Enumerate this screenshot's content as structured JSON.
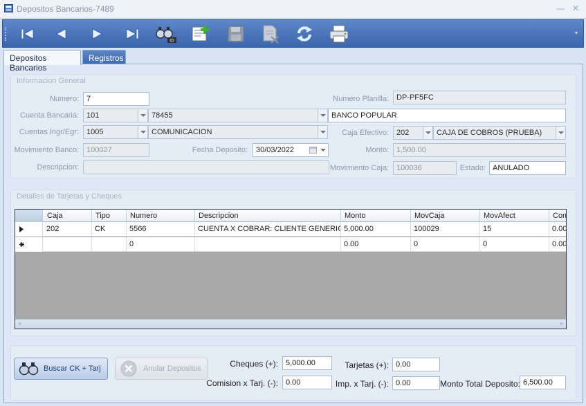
{
  "window": {
    "title": "Depositos Bancarios-7489",
    "min_symbol": "—",
    "close_symbol": "✕"
  },
  "toolbar": {
    "buttons": [
      {
        "name": "first-record-icon"
      },
      {
        "name": "previous-record-icon"
      },
      {
        "name": "next-record-icon"
      },
      {
        "name": "last-record-icon"
      },
      {
        "name": "find-by-id-icon",
        "badge": "ID"
      },
      {
        "name": "new-record-icon"
      },
      {
        "name": "save-icon"
      },
      {
        "name": "delete-document-icon"
      },
      {
        "name": "refresh-icon"
      },
      {
        "name": "print-icon"
      }
    ],
    "overflow": "▾"
  },
  "tabs": [
    {
      "label": "Depositos Bancarios",
      "active": true
    },
    {
      "label": "Registros",
      "active": false
    }
  ],
  "info": {
    "title": "Informacion General",
    "numero_label": "Numero:",
    "numero": "7",
    "planilla_label": "Numero Planilla:",
    "planilla": "DP-PF5FC",
    "cuenta_label": "Cuenta Bancaria:",
    "cuenta_code": "101",
    "cuenta_num": "78455",
    "cuenta_banco": "BANCO POPULAR",
    "ingr_label": "Cuentas Ingr/Egr:",
    "ingr_code": "1005",
    "ingr_desc": "COMUNICACION",
    "caja_label": "Caja Efectivo:",
    "caja_code": "202",
    "caja_desc": "CAJA DE COBROS (PRUEBA)",
    "mov_banco_label": "Movimiento Banco:",
    "mov_banco": "100027",
    "fecha_label": "Fecha Deposito:",
    "fecha": "30/03/2022",
    "monto_label": "Monto:",
    "monto": "1,500.00",
    "desc_label": "Descripcion:",
    "desc": "",
    "mov_caja_label": "Movimiento Caja:",
    "mov_caja": "100036",
    "estado_label": "Estado:",
    "estado": "ANULADO"
  },
  "details": {
    "title": "Detalles de Tarjetas y Cheques",
    "columns": [
      "Caja",
      "Tipo",
      "Numero",
      "Descripcion",
      "Monto",
      "MovCaja",
      "MovAfect",
      "Com"
    ],
    "rows": [
      {
        "marker": "current",
        "cells": [
          "202",
          "CK",
          "5566",
          "CUENTA X COBRAR: CLIENTE GENERICO",
          "5,000.00",
          "100029",
          "15",
          "0.00"
        ]
      },
      {
        "marker": "new",
        "cells": [
          "",
          "",
          "0",
          "",
          "0.00",
          "0",
          "0",
          "0.00"
        ]
      }
    ],
    "scroll_left": "◂",
    "scroll_right": "▸"
  },
  "actions": {
    "buscar_label": "Buscar CK + Tarj",
    "anular_label": "Anular Depositos"
  },
  "totals": {
    "cheques_label": "Cheques (+):",
    "cheques": "5,000.00",
    "tarjetas_label": "Tarjetas (+):",
    "tarjetas": "0.00",
    "comision_label": "Comision x Tarj. (-):",
    "comision": "0.00",
    "imp_label": "Imp. x Tarj. (-):",
    "imp": "0.00",
    "total_label": "Monto Total Deposito:",
    "total": "6,500.00"
  }
}
